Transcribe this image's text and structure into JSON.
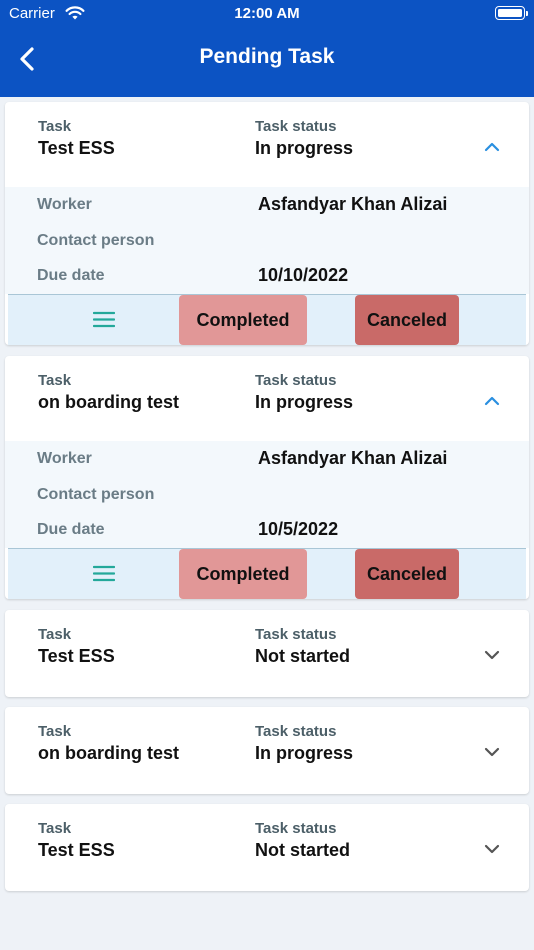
{
  "status_bar": {
    "carrier": "Carrier",
    "time": "12:00 AM"
  },
  "header": {
    "title": "Pending Task"
  },
  "labels": {
    "task": "Task",
    "task_status": "Task status",
    "worker": "Worker",
    "contact_person": "Contact person",
    "due_date": "Due date",
    "completed": "Completed",
    "canceled": "Canceled"
  },
  "tasks": [
    {
      "task": "Test ESS",
      "status": "In progress",
      "expanded": true,
      "worker": "Asfandyar Khan Alizai",
      "contact_person": "",
      "due_date": "10/10/2022"
    },
    {
      "task": "on boarding test",
      "status": "In progress",
      "expanded": true,
      "worker": "Asfandyar Khan Alizai",
      "contact_person": "",
      "due_date": "10/5/2022"
    },
    {
      "task": "Test ESS",
      "status": "Not started",
      "expanded": false
    },
    {
      "task": "on boarding test",
      "status": "In progress",
      "expanded": false
    },
    {
      "task": "Test ESS",
      "status": "Not started",
      "expanded": false
    }
  ],
  "colors": {
    "header_bg": "#0c53c3",
    "completed_btn": "#e19797",
    "canceled_btn": "#c96a68",
    "expanded_chevron": "#2a8fe0",
    "collapsed_chevron": "#555555",
    "menu_icon": "#23a89a"
  },
  "icons": {
    "back": "chevron-left-icon",
    "expand": "chevron-up-icon",
    "collapse": "chevron-down-icon",
    "menu": "hamburger-menu-icon"
  }
}
